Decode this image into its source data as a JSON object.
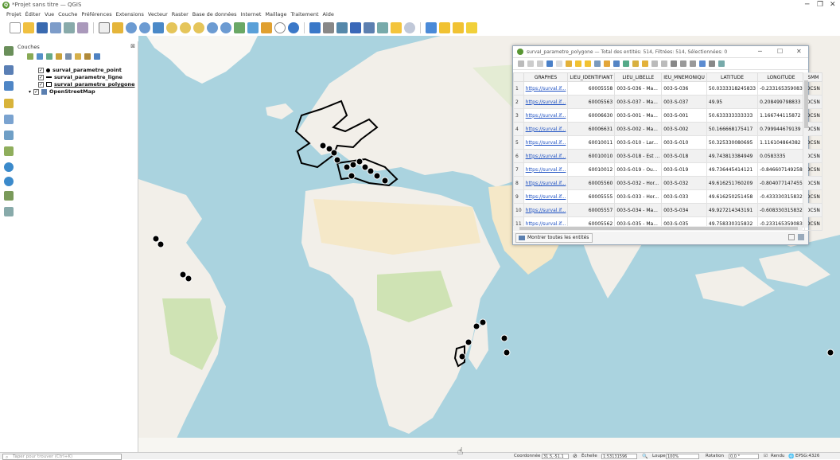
{
  "window": {
    "title": "*Projet sans titre — QGIS",
    "minimize": "─",
    "restore": "❐",
    "close": "✕",
    "app_icon_letter": "Q"
  },
  "menu": [
    "Projet",
    "Éditer",
    "Vue",
    "Couche",
    "Préférences",
    "Extensions",
    "Vecteur",
    "Raster",
    "Base de données",
    "Internet",
    "Maillage",
    "Traitement",
    "Aide"
  ],
  "layers_panel": {
    "title": "Couches",
    "close": "⊠",
    "layers": [
      {
        "name": "survaI_parametre_point",
        "checked": "✓",
        "symbol": "point"
      },
      {
        "name": "survaI_parametre_ligne",
        "checked": "✓",
        "symbol": "line"
      },
      {
        "name": "survaI_parametre_polygone",
        "checked": "✓",
        "symbol": "polygon"
      },
      {
        "name": "OpenStreetMap",
        "checked": "✓",
        "symbol": "tile"
      }
    ]
  },
  "attribute_table": {
    "title": "survaI_parametre_polygone — Total des entités: 514, Filtrées: 514, Sélectionnées: 0",
    "minimize": "─",
    "maximize": "☐",
    "close": "✕",
    "headers": [
      "",
      "GRAPHES",
      "LIEU_IDENTIFIANT",
      "LIEU_LIBELLE",
      "IEU_MNEMONIQU",
      "LATITUDE",
      "LONGITUDE",
      "SMM"
    ],
    "rows": [
      {
        "n": "1",
        "graphes": "https://surval.if...",
        "id": "60005558",
        "libelle": "003-S-036 - Ma...",
        "mnemo": "003-S-036",
        "lat": "50.0333318245833",
        "lon": "-0.233165359083",
        "smm": "DCSN"
      },
      {
        "n": "2",
        "graphes": "https://surval.if...",
        "id": "60005563",
        "libelle": "003-S-037 - Ma...",
        "mnemo": "003-S-037",
        "lat": "49.95",
        "lon": "0.208499798833",
        "smm": "DCSN"
      },
      {
        "n": "3",
        "graphes": "https://surval.if...",
        "id": "60006630",
        "libelle": "003-S-001 - Ma...",
        "mnemo": "003-S-001",
        "lat": "50.633333333333",
        "lon": "1.166744115872",
        "smm": "DCSN"
      },
      {
        "n": "4",
        "graphes": "https://surval.if...",
        "id": "60006631",
        "libelle": "003-S-002 - Ma...",
        "mnemo": "003-S-002",
        "lat": "50.166668175417",
        "lon": "0.799944679139",
        "smm": "DCSN"
      },
      {
        "n": "5",
        "graphes": "https://surval.if...",
        "id": "60010011",
        "libelle": "003-S-010 - Lar...",
        "mnemo": "003-S-010",
        "lat": "50.325330080695",
        "lon": "1.116104864382",
        "smm": "DCSN"
      },
      {
        "n": "6",
        "graphes": "https://surval.if...",
        "id": "60010010",
        "libelle": "003-S-018 - Est ...",
        "mnemo": "003-S-018",
        "lat": "49.743813384949",
        "lon": "0.0583335",
        "smm": "DCSN"
      },
      {
        "n": "7",
        "graphes": "https://surval.if...",
        "id": "60010012",
        "libelle": "003-S-019 - Ou...",
        "mnemo": "003-S-019",
        "lat": "49.736445414121",
        "lon": "-0.846607149258",
        "smm": "DCSN"
      },
      {
        "n": "8",
        "graphes": "https://surval.if...",
        "id": "60005560",
        "libelle": "003-S-032 - Hor...",
        "mnemo": "003-S-032",
        "lat": "49.616251760209",
        "lon": "-0.804077147455",
        "smm": "DCSN"
      },
      {
        "n": "9",
        "graphes": "https://surval.if...",
        "id": "60005555",
        "libelle": "003-S-033 - Hor...",
        "mnemo": "003-S-033",
        "lat": "49.616250251458",
        "lon": "-0.433330315832",
        "smm": "DCSN"
      },
      {
        "n": "10",
        "graphes": "https://surval.if...",
        "id": "60005557",
        "libelle": "003-S-034 - Ma...",
        "mnemo": "003-S-034",
        "lat": "49.927214343191",
        "lon": "-0.608330315832",
        "smm": "DCSN"
      },
      {
        "n": "11",
        "graphes": "https://surval.if...",
        "id": "60005562",
        "libelle": "003-S-035 - Ma...",
        "mnemo": "003-S-035",
        "lat": "49.758330315832",
        "lon": "-0.233165359083",
        "smm": "DCSN"
      }
    ],
    "show_all": "Montrer toutes les entités"
  },
  "statusbar": {
    "search_placeholder": "Taper pour trouver (Ctrl+K)",
    "coord_label": "Coordonnée",
    "coord_value": "31.5,-51.1",
    "scale_label": "Échelle",
    "scale_value": "1:53131596",
    "magnifier_label": "Loupe",
    "magnifier_value": "100%",
    "rotation_label": "Rotation",
    "rotation_value": "0,0 °",
    "render_label": "Rendu",
    "crs": "EPSG:4326"
  },
  "colors": {
    "ocean": "#aad3df",
    "land": "#f2efe9",
    "desert": "#f5e8c8",
    "forest": "#cfe3b4",
    "point": "#000000",
    "qgis_green": "#589632"
  }
}
